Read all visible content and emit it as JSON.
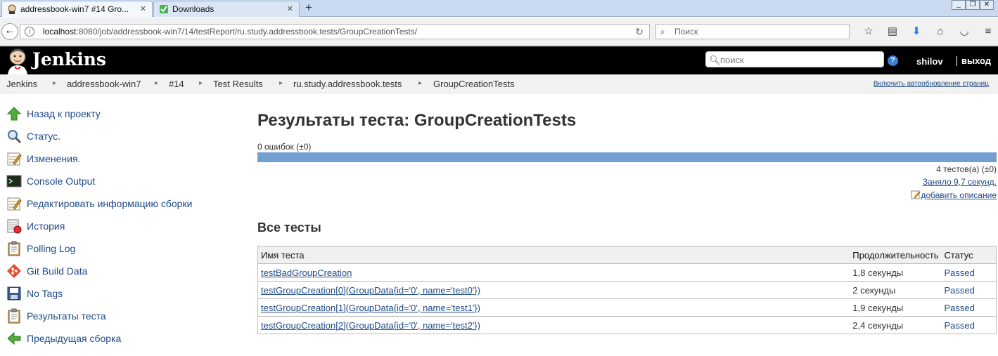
{
  "browser": {
    "tabs": [
      {
        "title": "addressbook-win7 #14 Gro..."
      },
      {
        "title": "Downloads"
      }
    ],
    "new_tab": "+",
    "window_controls": [
      "_",
      "❐",
      "✕"
    ],
    "url": {
      "host": "localhost",
      "rest": ":8080/job/addressbook-win7/14/testReport/ru.study.addressbook.tests/GroupCreationTests/"
    },
    "search_placeholder": "Поиск"
  },
  "jenkins": {
    "brand": "Jenkins",
    "search_placeholder": "поиск",
    "help": "?",
    "user": "shilov",
    "logout": "выход"
  },
  "breadcrumbs": [
    "Jenkins",
    "addressbook-win7",
    "#14",
    "Test Results",
    "ru.study.addressbook.tests",
    "GroupCreationTests"
  ],
  "auto_refresh": "Включить автообновление страниц",
  "sidebar": {
    "items": [
      {
        "label": "Назад к проекту",
        "icon": "up-arrow-icon"
      },
      {
        "label": "Статус.",
        "icon": "magnifier-icon"
      },
      {
        "label": "Изменения.",
        "icon": "notepad-icon"
      },
      {
        "label": "Console Output",
        "icon": "terminal-icon"
      },
      {
        "label": "Редактировать информацию сборки",
        "icon": "notepad-icon"
      },
      {
        "label": "История",
        "icon": "history-icon"
      },
      {
        "label": "Polling Log",
        "icon": "clipboard-icon"
      },
      {
        "label": "Git Build Data",
        "icon": "git-icon"
      },
      {
        "label": "No Tags",
        "icon": "floppy-icon"
      },
      {
        "label": "Результаты теста",
        "icon": "clipboard-icon"
      },
      {
        "label": "Предыдущая сборка",
        "icon": "left-arrow-icon"
      }
    ]
  },
  "main": {
    "title": "Результаты теста: GroupCreationTests",
    "fail_count": "0 ошибок (±0)",
    "progress_passed_fraction": 1.0,
    "test_count": "4 тестов(а) (±0)",
    "duration": "Заняло 9,7 секунд.",
    "add_description": "добавить описание",
    "all_tests_heading": "Все тесты",
    "table": {
      "headers": [
        "Имя теста",
        "Продолжительность",
        "Статус"
      ],
      "rows": [
        {
          "name": "testBadGroupCreation",
          "duration": "1,8 секунды",
          "status": "Passed"
        },
        {
          "name": "testGroupCreation[0](GroupData{id='0', name='test0'})",
          "duration": "2 секунды",
          "status": "Passed"
        },
        {
          "name": "testGroupCreation[1](GroupData{id='0', name='test1'})",
          "duration": "1,9 секунды",
          "status": "Passed"
        },
        {
          "name": "testGroupCreation[2](GroupData{id='0', name='test2'})",
          "duration": "2,4 секунды",
          "status": "Passed"
        }
      ]
    }
  },
  "colors": {
    "progress_bar": "#729fcf",
    "link": "#204a87",
    "header_bg": "#000000"
  }
}
